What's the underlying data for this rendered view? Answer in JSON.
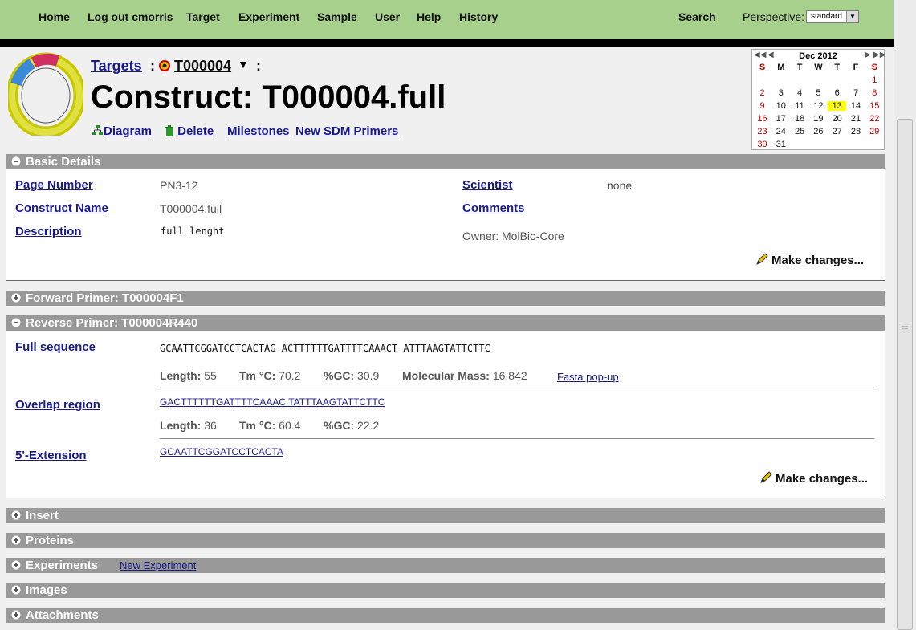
{
  "nav": {
    "items": [
      "Home",
      "Log out cmorris",
      "Target",
      "Experiment",
      "Sample",
      "User",
      "Help",
      "History"
    ],
    "search": "Search",
    "perspective_label": "Perspective:",
    "perspective_value": "standard"
  },
  "header": {
    "breadcrumb_targets": "Targets",
    "breadcrumb_sep": ":",
    "target": "T000004",
    "title": "Construct: T000004.full",
    "actions": [
      "Diagram",
      "Delete",
      "Milestones",
      "New SDM Primers"
    ]
  },
  "calendar": {
    "title": "Dec 2012",
    "days": [
      "S",
      "M",
      "T",
      "W",
      "T",
      "F",
      "S"
    ],
    "weeks": [
      [
        "",
        "",
        "",
        "",
        "",
        "",
        "1"
      ],
      [
        "2",
        "3",
        "4",
        "5",
        "6",
        "7",
        "8"
      ],
      [
        "9",
        "10",
        "11",
        "12",
        "13",
        "14",
        "15"
      ],
      [
        "16",
        "17",
        "18",
        "19",
        "20",
        "21",
        "22"
      ],
      [
        "23",
        "24",
        "25",
        "26",
        "27",
        "28",
        "29"
      ],
      [
        "30",
        "31",
        "",
        "",
        "",
        "",
        ""
      ]
    ],
    "today": "13"
  },
  "basic": {
    "title": "Basic Details",
    "page_number_label": "Page Number",
    "page_number": "PN3-12",
    "construct_name_label": "Construct Name",
    "construct_name": "T000004.full",
    "description_label": "Description",
    "description": "full lenght",
    "scientist_label": "Scientist",
    "scientist": "none",
    "comments_label": "Comments",
    "owner": "Owner: MolBio-Core",
    "make_changes": "Make changes..."
  },
  "forward": {
    "title": "Forward Primer: T000004F1"
  },
  "reverse": {
    "title": "Reverse Primer: T000004R440",
    "full_sequence_label": "Full sequence",
    "full_sequence": "GCAATTCGGATCCTCACTAG ACTTTTTTGATTTTCAAACT ATTTAAGTATTCTTC",
    "length_label": "Length:",
    "length": "55",
    "tm_label": "Tm °C:",
    "tm": "70.2",
    "gc_label": "%GC:",
    "gc": "30.9",
    "mass_label": "Molecular Mass:",
    "mass": "16,842",
    "fasta": "Fasta pop-up",
    "overlap_label": "Overlap region",
    "overlap": "GACTTTTTTGATTTTCAAAC TATTTAAGTATTCTTC",
    "overlap_length": "36",
    "overlap_tm": "60.4",
    "overlap_gc": "22.2",
    "extension_label": "5'-Extension",
    "extension": "GCAATTCGGATCCTCACTA",
    "make_changes": "Make changes..."
  },
  "sections": {
    "insert": "Insert",
    "proteins": "Proteins",
    "experiments": "Experiments",
    "new_experiment": "New Experiment",
    "images": "Images",
    "attachments": "Attachments"
  }
}
